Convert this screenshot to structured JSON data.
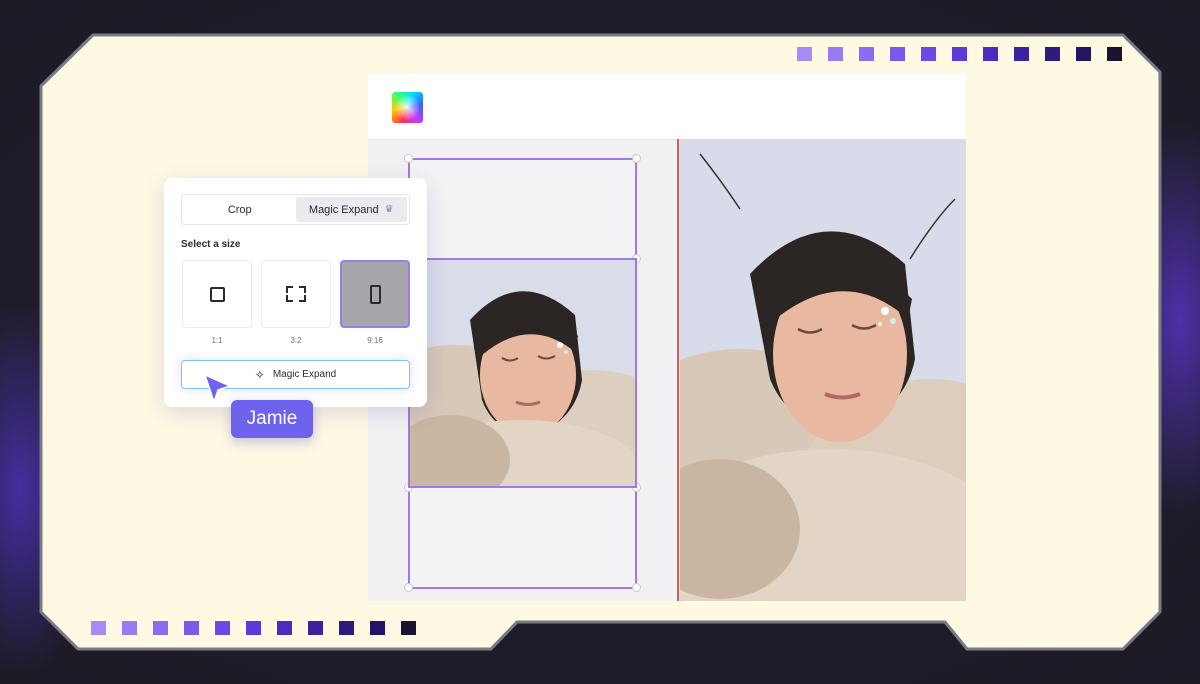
{
  "colors": {
    "panel_bg": "#fdf9e3",
    "frame_border": "#7a7a85",
    "accent_purple": "#9b7bea",
    "name_tag": "#6e63ee",
    "guide_line": "#e05555",
    "dot_ramp": [
      "#a98af5",
      "#9b7bf2",
      "#8b6bef",
      "#7a5aec",
      "#6b49e8",
      "#5b3ad8",
      "#4b2cc0",
      "#3d22a0",
      "#2f1b80",
      "#241664",
      "#1a1230"
    ]
  },
  "editor": {
    "logo_icon": "color-wheel-icon"
  },
  "panel": {
    "tabs": [
      {
        "label": "Crop",
        "active": false
      },
      {
        "label": "Magic Expand",
        "active": true,
        "icon": "crown-icon",
        "icon_glyph": "♛"
      }
    ],
    "select_size_label": "Select a size",
    "sizes": [
      {
        "label": "1:1",
        "icon": "square-icon",
        "selected": false
      },
      {
        "label": "3:2",
        "icon": "corners-icon",
        "selected": false
      },
      {
        "label": "9:16",
        "icon": "portrait-icon",
        "selected": true
      }
    ],
    "action_button": {
      "label": "Magic Expand",
      "icon": "sparkle-icon",
      "icon_glyph": "✧"
    }
  },
  "collaborator": {
    "name": "Jamie"
  }
}
